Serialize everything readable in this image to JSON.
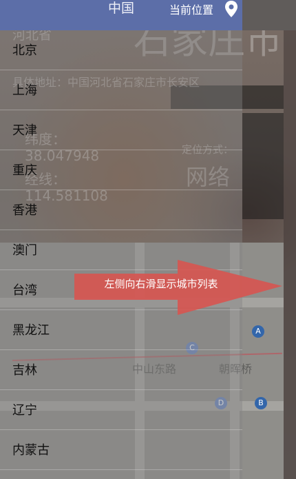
{
  "header": {
    "title": "中国",
    "location_label": "当前位置",
    "location_icon": "map-pin-icon"
  },
  "background": {
    "province": "河北省",
    "city": "石家庄市",
    "address": "具体地址：中国河北省石家庄市长安区",
    "latitude_label": "纬度：",
    "latitude_value": "38.047948",
    "longitude_label": "经线：",
    "longitude_value": "114.581108",
    "location_mode_label": "定位方式：",
    "location_mode_value": "网络",
    "map": {
      "road_label": "中山东路",
      "bridge_label": "朝晖桥",
      "pin_a": "A",
      "pin_b": "B",
      "pin_c": "C",
      "pin_d": "D"
    }
  },
  "drawer": {
    "cities": [
      "北京",
      "上海",
      "天津",
      "重庆",
      "香港",
      "澳门",
      "台湾",
      "黑龙江",
      "吉林",
      "辽宁",
      "内蒙古"
    ]
  },
  "hint": {
    "text": "左侧向右滑显示城市列表",
    "arrow_color": "#d9534f"
  },
  "colors": {
    "topbar": "#5c6ea8",
    "drawer_overlay": "#828282"
  }
}
